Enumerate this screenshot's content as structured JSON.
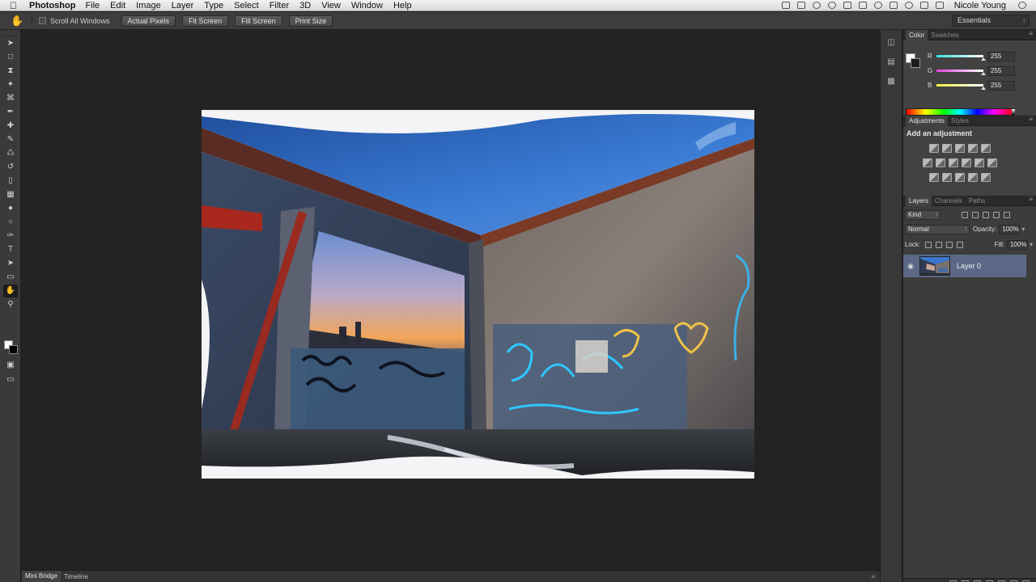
{
  "menubar": {
    "app_name": "Photoshop",
    "items": [
      "File",
      "Edit",
      "Image",
      "Layer",
      "Type",
      "Select",
      "Filter",
      "3D",
      "View",
      "Window",
      "Help"
    ],
    "user": "Nicole Young"
  },
  "options_bar": {
    "scroll_all_windows": "Scroll All Windows",
    "buttons": [
      "Actual Pixels",
      "Fit Screen",
      "Fill Screen",
      "Print Size"
    ],
    "workspace": "Essentials"
  },
  "tools": [
    "move-tool",
    "marquee-tool",
    "lasso-tool",
    "quick-select-tool",
    "crop-tool",
    "eyedropper-tool",
    "spot-healing-tool",
    "brush-tool",
    "clone-stamp-tool",
    "history-brush-tool",
    "eraser-tool",
    "gradient-tool",
    "blur-tool",
    "dodge-tool",
    "pen-tool",
    "type-tool",
    "path-select-tool",
    "rectangle-tool",
    "hand-tool",
    "zoom-tool"
  ],
  "color_panel": {
    "tabs": [
      "Color",
      "Swatches"
    ],
    "channels": [
      {
        "name": "R",
        "value": "255",
        "color": "#36e0e0"
      },
      {
        "name": "G",
        "value": "255",
        "color": "#e040e0"
      },
      {
        "name": "B",
        "value": "255",
        "color": "#f0f040"
      }
    ]
  },
  "adjustments_panel": {
    "tabs": [
      "Adjustments",
      "Styles"
    ],
    "title": "Add an adjustment"
  },
  "layers_panel": {
    "tabs": [
      "Layers",
      "Channels",
      "Paths"
    ],
    "kind": "Kind",
    "blend_mode": "Normal",
    "opacity_label": "Opacity:",
    "opacity": "100%",
    "lock_label": "Lock:",
    "fill_label": "Fill:",
    "fill": "100%",
    "layers": [
      {
        "name": "Layer 0",
        "visible": true,
        "selected": true
      }
    ]
  },
  "status_bar": {
    "tabs": [
      "Mini Bridge",
      "Timeline"
    ]
  }
}
